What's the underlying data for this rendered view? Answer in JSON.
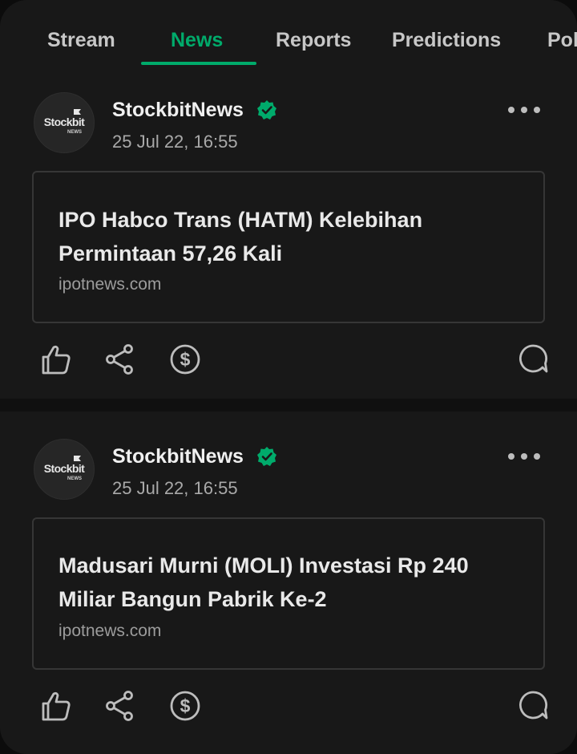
{
  "tabs": [
    {
      "label": "Stream"
    },
    {
      "label": "News"
    },
    {
      "label": "Reports"
    },
    {
      "label": "Predictions"
    },
    {
      "label": "Pol"
    }
  ],
  "active_tab": "News",
  "colors": {
    "accent": "#00ab6b",
    "background": "#181818",
    "text_primary": "#f0f0f0",
    "text_secondary": "#a9a9a9"
  },
  "posts": [
    {
      "avatar_text": "Stockbit",
      "avatar_subtext": "NEWS",
      "author": "StockbitNews",
      "verified_icon": "verified-badge-icon",
      "timestamp": "25 Jul 22, 16:55",
      "more_icon": "more-dots-icon",
      "article": {
        "title": "IPO Habco Trans (HATM) Kelebihan Permintaan 57,26 Kali",
        "source": "ipotnews.com"
      },
      "actions": [
        "thumbs-up-icon",
        "share-icon",
        "dollar-tip-icon",
        "comment-icon"
      ]
    },
    {
      "avatar_text": "Stockbit",
      "avatar_subtext": "NEWS",
      "author": "StockbitNews",
      "verified_icon": "verified-badge-icon",
      "timestamp": "25 Jul 22, 16:55",
      "more_icon": "more-dots-icon",
      "article": {
        "title": "Madusari Murni (MOLI) Investasi Rp 240 Miliar Bangun Pabrik Ke-2",
        "source": "ipotnews.com"
      },
      "actions": [
        "thumbs-up-icon",
        "share-icon",
        "dollar-tip-icon",
        "comment-icon"
      ]
    }
  ]
}
